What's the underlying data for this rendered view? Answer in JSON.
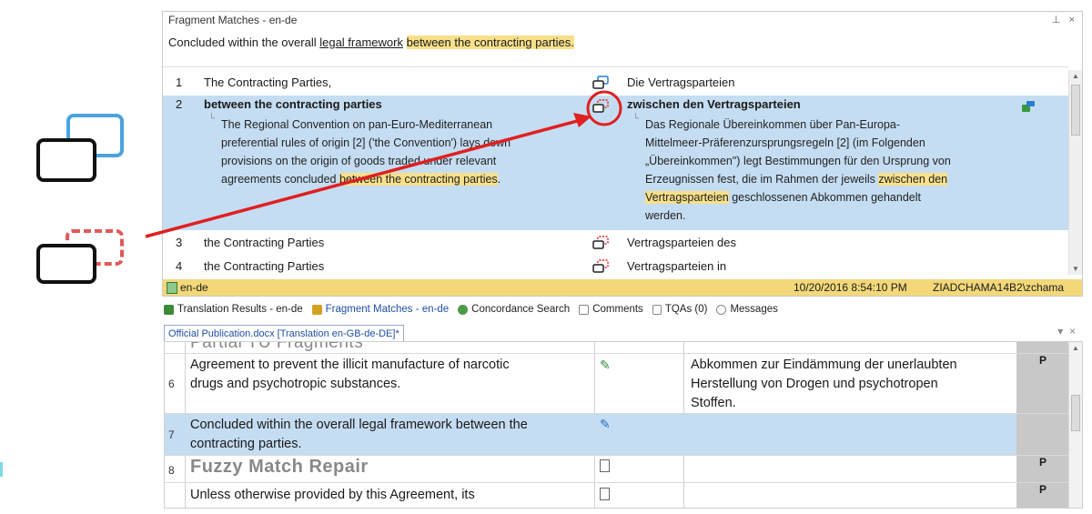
{
  "panel": {
    "title": "Fragment Matches - en-de",
    "pin": "ᨮ",
    "close": "×",
    "source_prefix": "Concluded within the overall ",
    "source_underlined": "legal framework",
    "source_space": " ",
    "source_highlight": "between the contracting parties."
  },
  "fragment_rows": [
    {
      "num": "1",
      "source": "The Contracting Parties,",
      "target": "Die Vertragsparteien"
    },
    {
      "num": "2",
      "source": "between the contracting parties",
      "target": "zwischen den Vertragsparteien",
      "detail_source_1": "The Regional Convention on pan-Euro-Mediterranean",
      "detail_source_2": "preferential rules of origin [2] ('the Convention') lays down",
      "detail_source_3": "provisions on the origin of goods traded under relevant",
      "detail_source_4a": "agreements concluded ",
      "detail_source_4b": "between the contracting parties",
      "detail_source_4c": ".",
      "detail_target_1": "Das Regionale Übereinkommen über Pan-Europa-",
      "detail_target_2": "Mittelmeer-Präferenzursprungsregeln [2] (im Folgenden",
      "detail_target_3": "„Übereinkommen\") legt Bestimmungen für den Ursprung von",
      "detail_target_4a": "Erzeugnissen fest, die im Rahmen der jeweils ",
      "detail_target_4b": "zwischen den",
      "detail_target_5a": "Vertragsparteien",
      "detail_target_5b": " geschlossenen Abkommen gehandelt",
      "detail_target_6": "werden."
    },
    {
      "num": "3",
      "source": "the Contracting Parties",
      "target": "Vertragsparteien des"
    },
    {
      "num": "4",
      "source": "the Contracting Parties",
      "target": "Vertragsparteien in"
    }
  ],
  "status_bar": {
    "lang": "en-de",
    "timestamp": "10/20/2016 8:54:10 PM",
    "user": "ZIADCHAMA14B2\\zchama"
  },
  "tabs": [
    {
      "label": "Translation Results - en-de"
    },
    {
      "label": "Fragment Matches - en-de"
    },
    {
      "label": "Concordance Search"
    },
    {
      "label": "Comments"
    },
    {
      "label": "TQAs (0)"
    },
    {
      "label": "Messages"
    }
  ],
  "document_tab": "Official Publication.docx [Translation en-GB-de-DE]*",
  "editor_rows": [
    {
      "num": "",
      "source": "Partial TU Fragments",
      "target": "",
      "status": ""
    },
    {
      "num": "6",
      "source_1": "Agreement to prevent the illicit manufacture of narcotic",
      "source_2": "drugs and psychotropic substances.",
      "target_1": "Abkommen zur Eindämmung der unerlaubten",
      "target_2": "Herstellung von Drogen und psychotropen",
      "target_3": "Stoffen.",
      "status": "P"
    },
    {
      "num": "7",
      "source_1": "Concluded within the overall legal framework between the",
      "source_2": "contracting parties.",
      "status": ""
    },
    {
      "num": "8",
      "source": "Fuzzy Match Repair",
      "status": "P"
    },
    {
      "num": "",
      "source": "Unless otherwise provided by this Agreement, its",
      "status": "P"
    }
  ],
  "colors": {
    "highlight": "#f8e08a",
    "selection": "#c5ddf2",
    "annotation_red": "#e02020",
    "legend_blue": "#4aa3dc",
    "legend_red_dashed": "#e05a5a"
  }
}
